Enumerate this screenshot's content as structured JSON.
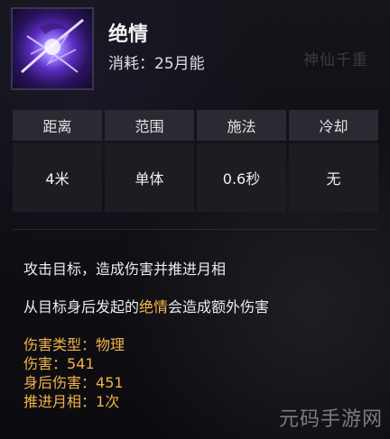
{
  "skill": {
    "name": "绝情",
    "cost": "消耗：25月能",
    "icon": "purple-slash-icon"
  },
  "background_text": "神仙千重",
  "stats": {
    "headers": [
      "距离",
      "范围",
      "施法",
      "冷却"
    ],
    "values": [
      "4米",
      "单体",
      "0.6秒",
      "无"
    ]
  },
  "description": {
    "line1": "攻击目标，造成伤害并推进月相",
    "line2_before": "从目标身后发起的",
    "line2_highlight": "绝情",
    "line2_after": "会造成额外伤害"
  },
  "properties": [
    {
      "key": "伤害类型：",
      "value": "物理"
    },
    {
      "key": "伤害：",
      "value": "541"
    },
    {
      "key": "身后伤害：",
      "value": "451"
    },
    {
      "key": "推进月相：",
      "value": "1次"
    }
  ],
  "watermark": "元码手游网",
  "colors": {
    "highlight": "#f5b84a",
    "header_cell": "#2a2b32",
    "value_cell": "#1c1d22"
  }
}
